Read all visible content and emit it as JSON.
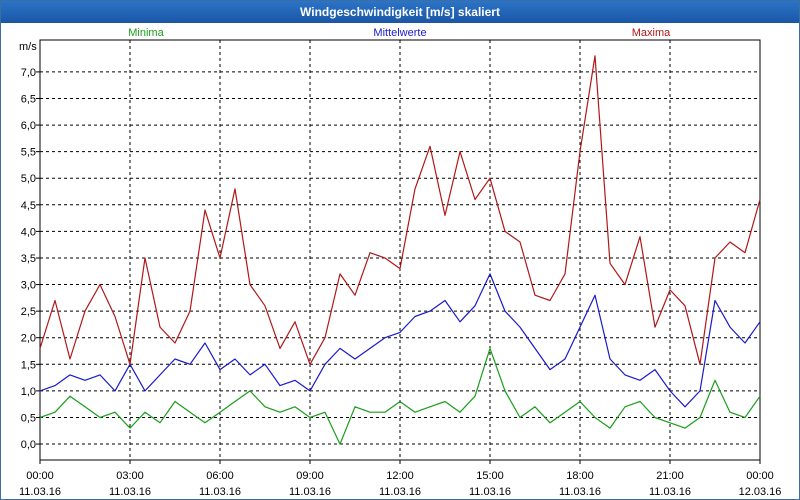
{
  "window": {
    "title": "Windgeschwindigkeit [m/s] skaliert"
  },
  "chart_data": {
    "type": "line",
    "title": "Windgeschwindigkeit [m/s] skaliert",
    "ylabel": "m/s",
    "ylim": [
      -0.3,
      7.6
    ],
    "y_ticks": [
      "0,0",
      "0,5",
      "1,0",
      "1,5",
      "2,0",
      "2,5",
      "3,0",
      "3,5",
      "4,0",
      "4,5",
      "5,0",
      "5,5",
      "6,0",
      "6,5",
      "7,0"
    ],
    "y_tick_values": [
      0,
      0.5,
      1,
      1.5,
      2,
      2.5,
      3,
      3.5,
      4,
      4.5,
      5,
      5.5,
      6,
      6.5,
      7
    ],
    "xlim_hours": [
      0,
      24
    ],
    "x_ticks": [
      {
        "hours": 0,
        "time": "00:00",
        "date": "11.03.16"
      },
      {
        "hours": 3,
        "time": "03:00",
        "date": "11.03.16"
      },
      {
        "hours": 6,
        "time": "06:00",
        "date": "11.03.16"
      },
      {
        "hours": 9,
        "time": "09:00",
        "date": "11.03.16"
      },
      {
        "hours": 12,
        "time": "12:00",
        "date": "11.03.16"
      },
      {
        "hours": 15,
        "time": "15:00",
        "date": "11.03.16"
      },
      {
        "hours": 18,
        "time": "18:00",
        "date": "11.03.16"
      },
      {
        "hours": 21,
        "time": "21:00",
        "date": "11.03.16"
      },
      {
        "hours": 24,
        "time": "00:00",
        "date": "12.03.16"
      }
    ],
    "grid": true,
    "legend_placement": "top",
    "series": [
      {
        "name": "Minima",
        "color": "#1a9e1a",
        "x_hours": [
          0,
          0.5,
          1,
          1.5,
          2,
          2.5,
          3,
          3.5,
          4,
          4.5,
          5,
          5.5,
          6,
          6.5,
          7,
          7.5,
          8,
          8.5,
          9,
          9.5,
          10,
          10.5,
          11,
          11.5,
          12,
          12.5,
          13,
          13.5,
          14,
          14.5,
          15,
          15.5,
          16,
          16.5,
          17,
          17.5,
          18,
          18.5,
          19,
          19.5,
          20,
          20.5,
          21,
          21.5,
          22,
          22.5,
          23,
          23.5,
          24
        ],
        "values": [
          0.5,
          0.6,
          0.9,
          0.7,
          0.5,
          0.6,
          0.3,
          0.6,
          0.4,
          0.8,
          0.6,
          0.4,
          0.6,
          0.8,
          1.0,
          0.7,
          0.6,
          0.7,
          0.5,
          0.6,
          0.0,
          0.7,
          0.6,
          0.6,
          0.8,
          0.6,
          0.7,
          0.8,
          0.6,
          0.9,
          1.8,
          1.0,
          0.5,
          0.7,
          0.4,
          0.6,
          0.8,
          0.5,
          0.3,
          0.7,
          0.8,
          0.5,
          0.4,
          0.3,
          0.5,
          1.2,
          0.6,
          0.5,
          0.9
        ]
      },
      {
        "name": "Mittelwerte",
        "color": "#1a1acc",
        "x_hours": [
          0,
          0.5,
          1,
          1.5,
          2,
          2.5,
          3,
          3.5,
          4,
          4.5,
          5,
          5.5,
          6,
          6.5,
          7,
          7.5,
          8,
          8.5,
          9,
          9.5,
          10,
          10.5,
          11,
          11.5,
          12,
          12.5,
          13,
          13.5,
          14,
          14.5,
          15,
          15.5,
          16,
          16.5,
          17,
          17.5,
          18,
          18.5,
          19,
          19.5,
          20,
          20.5,
          21,
          21.5,
          22,
          22.5,
          23,
          23.5,
          24
        ],
        "values": [
          1.0,
          1.1,
          1.3,
          1.2,
          1.3,
          1.0,
          1.5,
          1.0,
          1.3,
          1.6,
          1.5,
          1.9,
          1.4,
          1.6,
          1.3,
          1.5,
          1.1,
          1.2,
          1.0,
          1.5,
          1.8,
          1.6,
          1.8,
          2.0,
          2.1,
          2.4,
          2.5,
          2.7,
          2.3,
          2.6,
          3.2,
          2.5,
          2.2,
          1.8,
          1.4,
          1.6,
          2.2,
          2.8,
          1.6,
          1.3,
          1.2,
          1.4,
          1.0,
          0.7,
          1.0,
          2.7,
          2.2,
          1.9,
          2.3
        ]
      },
      {
        "name": "Maxima",
        "color": "#b01818",
        "x_hours": [
          0,
          0.5,
          1,
          1.5,
          2,
          2.5,
          3,
          3.5,
          4,
          4.5,
          5,
          5.5,
          6,
          6.5,
          7,
          7.5,
          8,
          8.5,
          9,
          9.5,
          10,
          10.5,
          11,
          11.5,
          12,
          12.5,
          13,
          13.5,
          14,
          14.5,
          15,
          15.5,
          16,
          16.5,
          17,
          17.5,
          18,
          18.5,
          19,
          19.5,
          20,
          20.5,
          21,
          21.5,
          22,
          22.5,
          23,
          23.5,
          24
        ],
        "values": [
          1.8,
          2.7,
          1.6,
          2.5,
          3.0,
          2.4,
          1.5,
          3.5,
          2.2,
          1.9,
          2.5,
          4.4,
          3.5,
          4.8,
          3.0,
          2.6,
          1.8,
          2.3,
          1.5,
          2.0,
          3.2,
          2.8,
          3.6,
          3.5,
          3.3,
          4.8,
          5.6,
          4.3,
          5.5,
          4.6,
          5.0,
          4.0,
          3.8,
          2.8,
          2.7,
          3.2,
          5.5,
          7.3,
          3.4,
          3.0,
          3.9,
          2.2,
          2.9,
          2.6,
          1.5,
          3.5,
          3.8,
          3.6,
          4.6
        ]
      }
    ]
  }
}
